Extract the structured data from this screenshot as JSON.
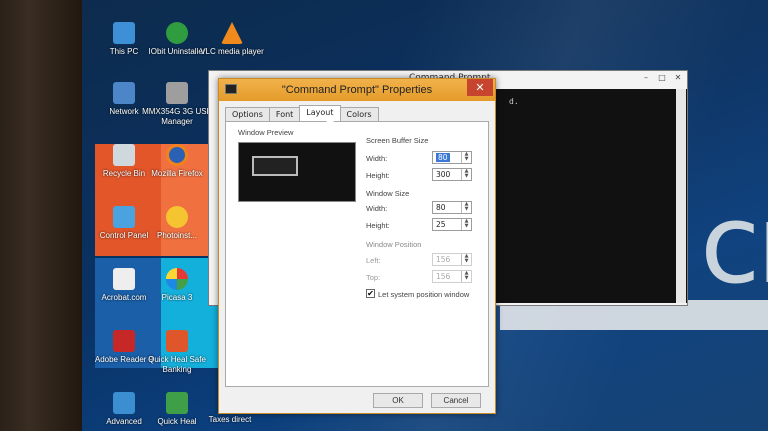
{
  "desktop": {
    "icons": [
      {
        "label": "This PC",
        "icon": "computer-icon"
      },
      {
        "label": "IObit Uninstaller",
        "icon": "iobit-icon"
      },
      {
        "label": "VLC media player",
        "icon": "vlc-icon"
      },
      {
        "label": "Network",
        "icon": "network-icon"
      },
      {
        "label": "MMX354G 3G USB Manager",
        "icon": "usb-manager-icon"
      },
      {
        "label": "Recycle Bin",
        "icon": "recycle-bin-icon"
      },
      {
        "label": "Mozilla Firefox",
        "icon": "firefox-icon"
      },
      {
        "label": "Control Panel",
        "icon": "control-panel-icon"
      },
      {
        "label": "Photoinst...",
        "icon": "photo-icon"
      },
      {
        "label": "Acrobat.com",
        "icon": "acrobat-icon"
      },
      {
        "label": "Picasa 3",
        "icon": "picasa-icon"
      },
      {
        "label": "Adobe Reader 9",
        "icon": "adobe-reader-icon"
      },
      {
        "label": "Quick Heal Safe Banking",
        "icon": "quickheal-banking-icon"
      },
      {
        "label": "Advanced",
        "icon": "advanced-icon"
      },
      {
        "label": "Quick Heal",
        "icon": "quickheal-icon"
      },
      {
        "label": "Taxes direct",
        "icon": "taxes-icon"
      }
    ]
  },
  "cmd_window": {
    "title": "Command Prompt",
    "text": "d."
  },
  "dialog": {
    "title": "\"Command Prompt\" Properties",
    "close": "✕",
    "tabs": [
      "Options",
      "Font",
      "Layout",
      "Colors"
    ],
    "active_tab": "Layout",
    "window_preview_label": "Window Preview",
    "screen_buffer_size": {
      "label": "Screen Buffer Size",
      "width_label": "Width:",
      "width": "80",
      "height_label": "Height:",
      "height": "300"
    },
    "window_size": {
      "label": "Window Size",
      "width_label": "Width:",
      "width": "80",
      "height_label": "Height:",
      "height": "25"
    },
    "window_position": {
      "label": "Window Position",
      "left_label": "Left:",
      "left": "156",
      "top_label": "Top:",
      "top": "156",
      "checkbox_label": "Let system position window",
      "checked": true
    },
    "ok_label": "OK",
    "cancel_label": "Cancel"
  }
}
